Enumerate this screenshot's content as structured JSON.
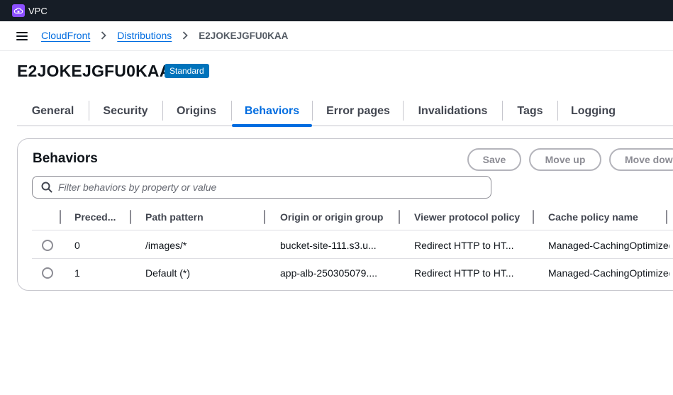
{
  "topbar": {
    "service_label": "VPC",
    "service_icon": "cloud-lock-icon"
  },
  "breadcrumb": {
    "items": [
      "CloudFront",
      "Distributions"
    ],
    "current": "E2JOKEJGFU0KAA"
  },
  "header": {
    "title": "E2JOKEJGFU0KAA",
    "badge": "Standard"
  },
  "tabs": [
    {
      "label": "General"
    },
    {
      "label": "Security"
    },
    {
      "label": "Origins"
    },
    {
      "label": "Behaviors",
      "active": true
    },
    {
      "label": "Error pages"
    },
    {
      "label": "Invalidations"
    },
    {
      "label": "Tags"
    },
    {
      "label": "Logging"
    }
  ],
  "behaviors": {
    "title": "Behaviors",
    "buttons": {
      "save": "Save",
      "move_up": "Move up",
      "move_down": "Move down"
    },
    "search": {
      "placeholder": "Filter behaviors by property or value",
      "value": ""
    },
    "columns": [
      "Preced...",
      "Path pattern",
      "Origin or origin group",
      "Viewer protocol policy",
      "Cache policy name"
    ],
    "rows": [
      {
        "precedence": "0",
        "path": "/images/*",
        "origin": "bucket-site-111.s3.u...",
        "viewer": "Redirect HTTP to HT...",
        "cache": "Managed-CachingOptimized"
      },
      {
        "precedence": "1",
        "path": "Default (*)",
        "origin": "app-alb-250305079....",
        "viewer": "Redirect HTTP to HT...",
        "cache": "Managed-CachingOptimized"
      }
    ]
  },
  "colors": {
    "accent": "#006ce0",
    "topbar": "#161d26",
    "badge": "#0073bb",
    "service_icon": "#8c4fff"
  }
}
